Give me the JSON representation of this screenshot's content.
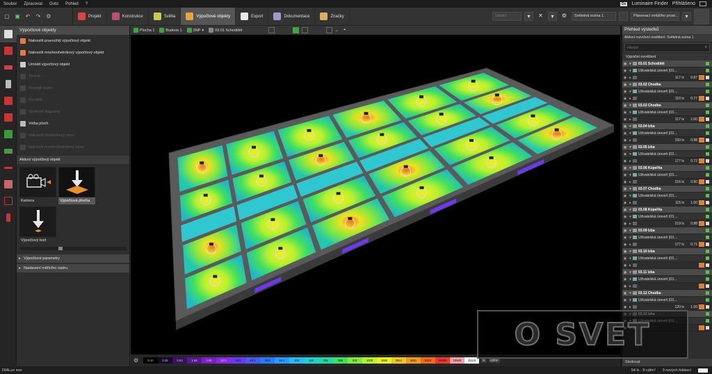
{
  "menubar": {
    "items": [
      "Soubor",
      "Zpracovat",
      "Goto",
      "Pohled",
      "?"
    ],
    "dx_badge": "Dx",
    "finder": "Luminaire Finder",
    "login": "Přihlášeno"
  },
  "toolbar": {
    "tabs": [
      {
        "label": "Projekt",
        "icon": "project-icon",
        "color": "#d94444"
      },
      {
        "label": "Konstrukce",
        "icon": "construction-icon",
        "color": "#c0506a"
      },
      {
        "label": "Světla",
        "icon": "lamp-icon",
        "color": "#c9c94a"
      },
      {
        "label": "Výpočtové objekty",
        "icon": "calc-objects-icon",
        "color": "#e8a43a"
      },
      {
        "label": "Export",
        "icon": "export-icon",
        "color": "#e8e8e8"
      },
      {
        "label": "Dokumentace",
        "icon": "documentation-icon",
        "color": "#9b9bd1"
      },
      {
        "label": "Značky",
        "icon": "marks-icon",
        "color": "#d8b060"
      }
    ],
    "active_tab": 3,
    "scene_dropdown": "Světelná scéna 1",
    "plan_dropdown": "Plánovací vnějšího prost...",
    "dim_dropdown": "Vlastní"
  },
  "left_panel": {
    "title": "Výpočtové objekty",
    "tools": [
      {
        "label": "Nakreslit pravoúhlý výpočtový objekt",
        "enabled": true,
        "color": "#e27d3a"
      },
      {
        "label": "Nakreslit mnohoúhelníkový výpočtový objekt",
        "enabled": true,
        "color": "#e27d3a"
      },
      {
        "label": "Umístit výpočtový objekt",
        "enabled": true,
        "color": "#cccccc"
      },
      {
        "label": "Změnit",
        "enabled": false,
        "color": "#555555"
      },
      {
        "label": "Rozpojit kopie",
        "enabled": false,
        "color": "#555555"
      },
      {
        "label": "Rozdělit",
        "enabled": false,
        "color": "#555555"
      },
      {
        "label": "Sjednotit diagramy",
        "enabled": false,
        "color": "#555555"
      },
      {
        "label": "Volba ploch",
        "enabled": true,
        "color": "#bbbbbb"
      },
      {
        "label": "Nakreslit obdélníkový otvor",
        "enabled": false,
        "color": "#555555"
      },
      {
        "label": "Nakreslit mnohoúhelníkový otvor",
        "enabled": false,
        "color": "#555555"
      }
    ],
    "active_header": "Aktivní výpočtový objekt",
    "objects": [
      {
        "label": "Kamera",
        "icon": "camera-icon",
        "selected": false
      },
      {
        "label": "Výpočtová plocha",
        "icon": "calc-surface-icon",
        "selected": true
      },
      {
        "label": "Výpočtový bod",
        "icon": "calc-point-icon",
        "selected": false
      }
    ],
    "sections": [
      "Výpočtové parametry",
      "Nastavení měřicího rastru"
    ]
  },
  "viewport_toolbar": {
    "items": [
      "Plocha 1",
      "Budova 1",
      "3NP",
      "03.01 Schodiště"
    ]
  },
  "legend": {
    "values": [
      "0.10",
      "0.25",
      "0.63",
      "1.58",
      "3.98",
      "10.0",
      "15.8",
      "25.1",
      "39.8",
      "63.1",
      "100",
      "158",
      "251",
      "398",
      "631",
      "1000",
      "1585",
      "2512",
      "3981",
      "6310",
      "10000",
      "15849",
      "25119"
    ],
    "colors": [
      "#000000",
      "#1a0a2a",
      "#3a1060",
      "#5a1890",
      "#7a20c0",
      "#8a2ae0",
      "#6a3af0",
      "#4a5af0",
      "#2a7aff",
      "#2a9aff",
      "#2abaf0",
      "#20d0d0",
      "#20d8a0",
      "#40e060",
      "#80e840",
      "#b8f030",
      "#e8f020",
      "#f0c820",
      "#f09a20",
      "#f06a20",
      "#e83a30",
      "#f0a0a0",
      "#ffffff"
    ],
    "unit_lx": "lx",
    "unit_cd": "cd/m²"
  },
  "status": {
    "brand": "DIALux evo",
    "readout": "54 lx · 9 cd/m²",
    "messages": "3 nových hlášení"
  },
  "right_panel": {
    "title": "Přehled výsledků",
    "subtitle": "Aktivní rozvržení osvětlení: Světelná scéna 1",
    "search_placeholder": "Hledat",
    "group": "Výpočet osvětlení",
    "sub_label": "Uživatelská úroveň (03....",
    "rooms": [
      {
        "name": "03.01 Schodiště",
        "lx": "117 lx",
        "u0": "0.87"
      },
      {
        "name": "03.02 Chodba",
        "lx": "110 lx",
        "u0": "0.77"
      },
      {
        "name": "03.03 Chodba",
        "lx": "117 lx",
        "u0": "1.00"
      },
      {
        "name": "03.04 Izba",
        "lx": "150 lx",
        "u0": "0.88"
      },
      {
        "name": "03.05 Izba",
        "lx": "177 lx",
        "u0": "0.72"
      },
      {
        "name": "03.06 Kúpeľňa",
        "lx": "216 lx",
        "u0": "0.90"
      },
      {
        "name": "03.07 Chodba",
        "lx": "115 lx",
        "u0": "1.00"
      },
      {
        "name": "03.08 Kúpeľňa",
        "lx": "219 lx",
        "u0": "0.88"
      },
      {
        "name": "03.09 Izba",
        "lx": "177 lx",
        "u0": "0.71"
      },
      {
        "name": "03.10 Izba",
        "lx": "",
        "u0": ""
      },
      {
        "name": "03.11 Izba",
        "lx": "",
        "u0": ""
      },
      {
        "name": "03.12 Chodba",
        "lx": "120 lx",
        "u0": "1.00"
      },
      {
        "name": "03.13 Izba",
        "lx": "",
        "u0": ""
      }
    ],
    "bottom": "Sledovat"
  },
  "watermark": "O SVET"
}
